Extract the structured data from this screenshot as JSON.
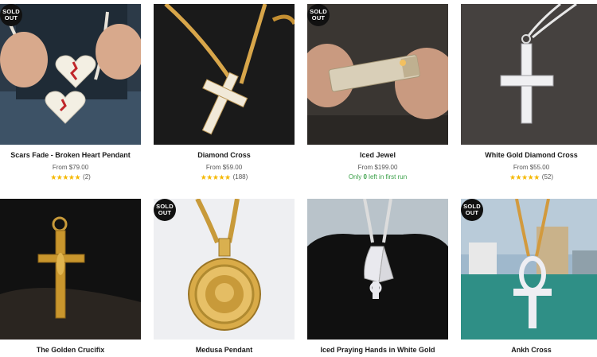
{
  "products": [
    {
      "title": "Scars Fade - Broken Heart Pendant",
      "price": "From $79.00",
      "stars": "★★★★★",
      "reviews": "(2)",
      "sold_out": true,
      "badge_line1": "SOLD",
      "badge_line2": "OUT"
    },
    {
      "title": "Diamond Cross",
      "price": "From $59.00",
      "stars": "★★★★★",
      "reviews": "(188)",
      "sold_out": false
    },
    {
      "title": "Iced Jewel",
      "price": "From $199.00",
      "stock_prefix": "Only ",
      "stock_count": "0",
      "stock_suffix": " left in first run",
      "sold_out": true,
      "badge_line1": "SOLD",
      "badge_line2": "OUT"
    },
    {
      "title": "White Gold Diamond Cross",
      "price": "From $55.00",
      "stars": "★★★★★",
      "reviews": "(52)",
      "sold_out": false
    },
    {
      "title": "The Golden Crucifix",
      "sold_out": false
    },
    {
      "title": "Medusa Pendant",
      "sold_out": true,
      "badge_line1": "SOLD",
      "badge_line2": "OUT"
    },
    {
      "title": "Iced Praying Hands in White Gold",
      "sold_out": false
    },
    {
      "title": "Ankh Cross",
      "sold_out": true,
      "badge_line1": "SOLD",
      "badge_line2": "OUT"
    }
  ],
  "colors": {
    "accent_star": "#f5b800",
    "stock_green": "#3aa048",
    "badge_bg": "#111111"
  }
}
